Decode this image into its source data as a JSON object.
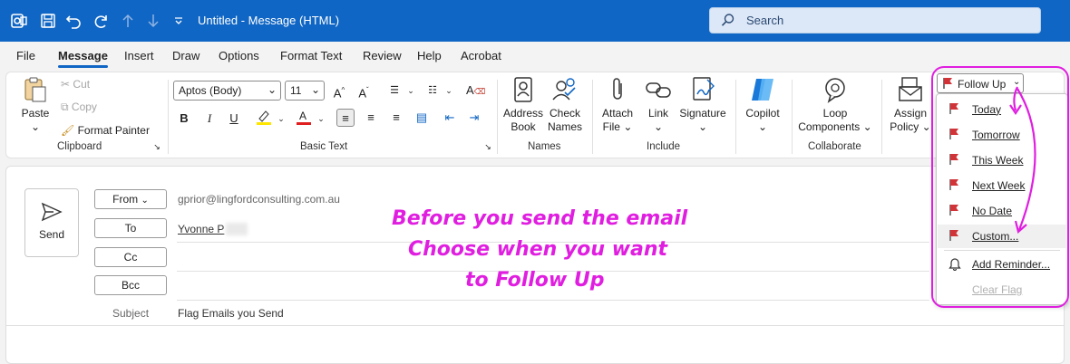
{
  "titlebar": {
    "title": "Untitled  -  Message (HTML)",
    "search_placeholder": "Search"
  },
  "menu": [
    "File",
    "Message",
    "Insert",
    "Draw",
    "Options",
    "Format Text",
    "Review",
    "Help",
    "Acrobat"
  ],
  "ribbon": {
    "clipboard": {
      "paste": "Paste",
      "cut": "Cut",
      "copy": "Copy",
      "format_painter": "Format Painter",
      "group": "Clipboard"
    },
    "basic_text": {
      "font": "Aptos (Body)",
      "size": "11",
      "group": "Basic Text",
      "bold": "B",
      "italic": "I",
      "underline": "U"
    },
    "names": {
      "address_book_1": "Address",
      "address_book_2": "Book",
      "check_names_1": "Check",
      "check_names_2": "Names",
      "group": "Names"
    },
    "include": {
      "attach_1": "Attach",
      "attach_2": "File",
      "link": "Link",
      "signature": "Signature",
      "group": "Include"
    },
    "copilot": "Copilot",
    "collaborate": {
      "loop_1": "Loop",
      "loop_2": "Components",
      "group": "Collaborate"
    },
    "assign_1": "Assign",
    "assign_2": "Policy",
    "follow_up": "Follow Up"
  },
  "followup_menu": [
    {
      "label": "Today",
      "flag": true,
      "state": "normal"
    },
    {
      "label": "Tomorrow",
      "flag": true,
      "state": "normal"
    },
    {
      "label": "This Week",
      "flag": true,
      "state": "normal"
    },
    {
      "label": "Next Week",
      "flag": true,
      "state": "normal"
    },
    {
      "label": "No Date",
      "flag": true,
      "state": "normal"
    },
    {
      "label": "Custom...",
      "flag": true,
      "state": "hover"
    },
    {
      "label": "Add Reminder...",
      "icon": "bell-icon",
      "state": "normal"
    },
    {
      "label": "Clear Flag",
      "state": "disabled"
    }
  ],
  "compose": {
    "send": "Send",
    "from_label": "From",
    "from_value": "gprior@lingfordconsulting.com.au",
    "to_label": "To",
    "to_value": "Yvonne P",
    "cc_label": "Cc",
    "bcc_label": "Bcc",
    "subject_label": "Subject",
    "subject_value": "Flag Emails you Send"
  },
  "annotation": [
    "Before you send the email",
    "Choose when you want",
    "to Follow Up"
  ],
  "colors": {
    "accent": "#1066c4",
    "annotation": "#e01ee0",
    "flag": "#d13438"
  }
}
